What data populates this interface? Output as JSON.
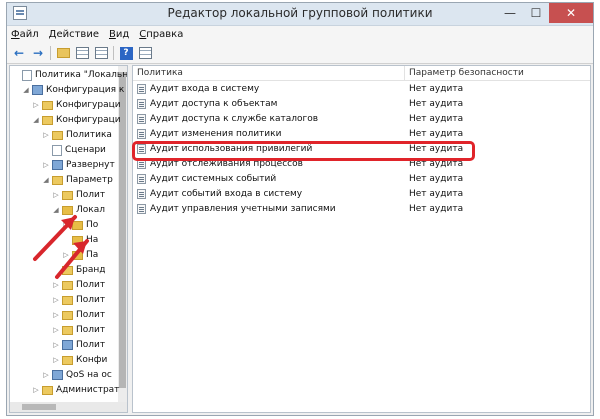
{
  "window": {
    "title": "Редактор локальной групповой политики"
  },
  "title_buttons": {
    "minimize": "—",
    "maximize": "☐",
    "close": "✕"
  },
  "menu": [
    "Файл",
    "Действие",
    "Вид",
    "Справка"
  ],
  "toolbar": {
    "back": "←",
    "forward": "→",
    "help": "?"
  },
  "tree": [
    {
      "label": "Политика \"Локальный",
      "depth": 0,
      "expander": "",
      "icon": "doc"
    },
    {
      "label": "Конфигурация к",
      "depth": 1,
      "expander": "◢",
      "icon": "computer"
    },
    {
      "label": "Конфигураци",
      "depth": 2,
      "expander": "▷",
      "icon": "folder"
    },
    {
      "label": "Конфигураци",
      "depth": 2,
      "expander": "◢",
      "icon": "folder"
    },
    {
      "label": "Политика",
      "depth": 3,
      "expander": "▷",
      "icon": "folder"
    },
    {
      "label": "Сценари",
      "depth": 3,
      "expander": "",
      "icon": "doc"
    },
    {
      "label": "Развернут",
      "depth": 3,
      "expander": "▷",
      "icon": "computer"
    },
    {
      "label": "Параметр",
      "depth": 3,
      "expander": "◢",
      "icon": "folder"
    },
    {
      "label": "Полит",
      "depth": 4,
      "expander": "▷",
      "icon": "folder"
    },
    {
      "label": "Локал",
      "depth": 4,
      "expander": "◢",
      "icon": "lock"
    },
    {
      "label": "По",
      "depth": 5,
      "expander": "▷",
      "icon": "lock"
    },
    {
      "label": "На",
      "depth": 5,
      "expander": "",
      "icon": "lock"
    },
    {
      "label": "Па",
      "depth": 5,
      "expander": "▷",
      "icon": "lock"
    },
    {
      "label": "Бранд",
      "depth": 4,
      "expander": "",
      "icon": "folder"
    },
    {
      "label": "Полит",
      "depth": 4,
      "expander": "▷",
      "icon": "folder"
    },
    {
      "label": "Полит",
      "depth": 4,
      "expander": "▷",
      "icon": "folder"
    },
    {
      "label": "Полит",
      "depth": 4,
      "expander": "▷",
      "icon": "folder"
    },
    {
      "label": "Полит",
      "depth": 4,
      "expander": "▷",
      "icon": "folder"
    },
    {
      "label": "Полит",
      "depth": 4,
      "expander": "▷",
      "icon": "computer"
    },
    {
      "label": "Конфи",
      "depth": 4,
      "expander": "▷",
      "icon": "folder"
    },
    {
      "label": "QoS на ос",
      "depth": 3,
      "expander": "▷",
      "icon": "computer"
    },
    {
      "label": "Администрат",
      "depth": 2,
      "expander": "▷",
      "icon": "folder"
    }
  ],
  "list": {
    "headers": {
      "policy": "Политика",
      "setting": "Параметр безопасности"
    },
    "rows": [
      {
        "policy": "Аудит входа в систему",
        "setting": "Нет аудита"
      },
      {
        "policy": "Аудит доступа к объектам",
        "setting": "Нет аудита"
      },
      {
        "policy": "Аудит доступа к службе каталогов",
        "setting": "Нет аудита"
      },
      {
        "policy": "Аудит изменения политики",
        "setting": "Нет аудита"
      },
      {
        "policy": "Аудит использования привилегий",
        "setting": "Нет аудита"
      },
      {
        "policy": "Аудит отслеживания процессов",
        "setting": "Нет аудита"
      },
      {
        "policy": "Аудит системных событий",
        "setting": "Нет аудита"
      },
      {
        "policy": "Аудит событий входа в систему",
        "setting": "Нет аудита"
      },
      {
        "policy": "Аудит управления учетными записями",
        "setting": "Нет аудита"
      }
    ]
  },
  "colors": {
    "highlight": "#e0242a",
    "arrow": "#d8262c",
    "title_bar": "#dce6f0",
    "close_button": "#c75050"
  }
}
